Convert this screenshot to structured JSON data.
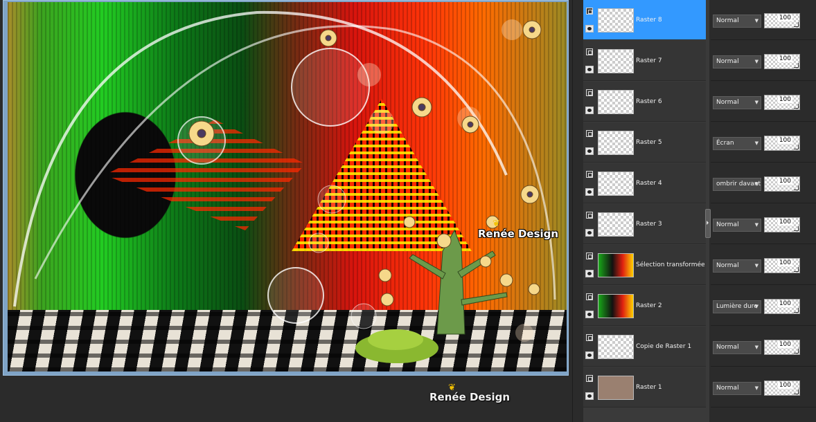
{
  "watermark": {
    "inner": "Renée Design",
    "bottom": "Renée Design"
  },
  "colors": {
    "selected_layer": "#3399ff",
    "frame": "#7fa3c6",
    "panel_bg": "#2b2b2b"
  },
  "layers": [
    {
      "name": "Raster 8",
      "blend": "Normal",
      "opacity": "100",
      "selected": true,
      "thumb": "transparent"
    },
    {
      "name": "Raster 7",
      "blend": "Normal",
      "opacity": "100",
      "selected": false,
      "thumb": "transparent"
    },
    {
      "name": "Raster 6",
      "blend": "Normal",
      "opacity": "100",
      "selected": false,
      "thumb": "transparent"
    },
    {
      "name": "Raster 5",
      "blend": "Écran",
      "opacity": "100",
      "selected": false,
      "thumb": "transparent"
    },
    {
      "name": "Raster 4",
      "blend": "ombrir davantag",
      "opacity": "100",
      "selected": false,
      "thumb": "transparent"
    },
    {
      "name": "Raster 3",
      "blend": "Normal",
      "opacity": "100",
      "selected": false,
      "thumb": "transparent"
    },
    {
      "name": "Sélection transformée",
      "blend": "Normal",
      "opacity": "100",
      "selected": false,
      "thumb": "colorful"
    },
    {
      "name": "Raster 2",
      "blend": "Lumière dure",
      "opacity": "100",
      "selected": false,
      "thumb": "colorful"
    },
    {
      "name": "Copie de Raster 1",
      "blend": "Normal",
      "opacity": "100",
      "selected": false,
      "thumb": "transparent"
    },
    {
      "name": "Raster 1",
      "blend": "Normal",
      "opacity": "100",
      "selected": false,
      "thumb": "solid"
    }
  ],
  "icons": {
    "link": "layer-link-icon",
    "visibility": "eye-icon",
    "dropdown": "chevron-down-icon"
  }
}
